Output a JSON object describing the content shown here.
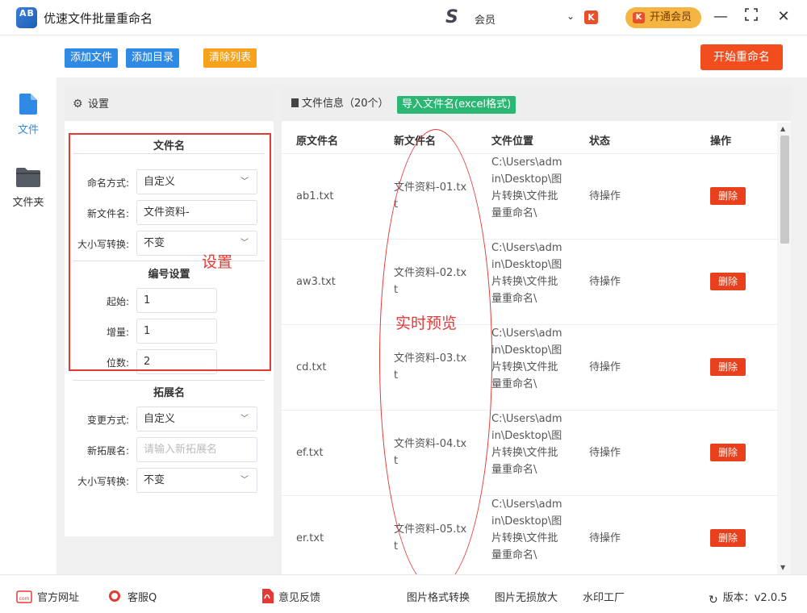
{
  "app": {
    "title": "优速文件批量重命名",
    "logo_text": "AB",
    "brand_logo": "S",
    "user_name": "会员",
    "brand_mark": "K",
    "vip_button": "开通会员",
    "min_glyph": "—",
    "max_glyph": "⛶",
    "close_glyph": "✕"
  },
  "nav": {
    "items": [
      {
        "label": "文件",
        "icon": "file-icon",
        "active": true
      },
      {
        "label": "文件夹",
        "icon": "folder-icon",
        "active": false
      }
    ]
  },
  "toolbar": {
    "add_file": "添加文件",
    "add_dir": "添加目录",
    "clear_list": "清除列表",
    "start_rename": "开始重命名"
  },
  "settings": {
    "header": "设置",
    "filename_section": "文件名",
    "naming_label": "命名方式:",
    "naming_value": "自定义",
    "newname_label": "新文件名:",
    "newname_value": "文件资料-",
    "case_label": "大小写转换:",
    "case_value": "不变",
    "numbering_section": "编号设置",
    "start_label": "起始:",
    "start_value": "1",
    "step_label": "增量:",
    "step_value": "1",
    "digits_label": "位数:",
    "digits_value": "2",
    "ext_section": "拓展名",
    "ext_mode_label": "变更方式:",
    "ext_mode_value": "自定义",
    "ext_new_label": "新拓展名:",
    "ext_new_placeholder": "请输入新拓展名",
    "ext_case_label": "大小写转换:",
    "ext_case_value": "不变"
  },
  "annotations": {
    "settings": "设置",
    "preview": "实时预览"
  },
  "filelist": {
    "header": "文件信息（20个）",
    "import_button": "导入文件名(excel格式)",
    "columns": [
      "原文件名",
      "新文件名",
      "文件位置",
      "状态",
      "操作"
    ],
    "rows": [
      {
        "original": "ab1.txt",
        "new": "文件资料-01.txt",
        "location": "C:\\Users\\admin\\Desktop\\图片转换\\文件批量重命名\\",
        "status": "待操作",
        "action": "删除"
      },
      {
        "original": "aw3.txt",
        "new": "文件资料-02.txt",
        "location": "C:\\Users\\admin\\Desktop\\图片转换\\文件批量重命名\\",
        "status": "待操作",
        "action": "删除"
      },
      {
        "original": "cd.txt",
        "new": "文件资料-03.txt",
        "location": "C:\\Users\\admin\\Desktop\\图片转换\\文件批量重命名\\",
        "status": "待操作",
        "action": "删除"
      },
      {
        "original": "ef.txt",
        "new": "文件资料-04.txt",
        "location": "C:\\Users\\admin\\Desktop\\图片转换\\文件批量重命名\\",
        "status": "待操作",
        "action": "删除"
      },
      {
        "original": "er.txt",
        "new": "文件资料-05.txt",
        "location": "C:\\Users\\admin\\Desktop\\图片转换\\文件批量重命名\\",
        "status": "待操作",
        "action": "删除"
      }
    ]
  },
  "footer": {
    "website": "官方网址",
    "support": "客服Q",
    "feedback": "意见反馈",
    "link1": "图片格式转换",
    "link2": "图片无损放大",
    "link3": "水印工厂",
    "version": "版本：v2.0.5"
  },
  "colors": {
    "blue_button": "#2f8ae5",
    "orange_button": "#f7a21c",
    "start_button": "#f24d1f",
    "import_button": "#2bb673",
    "delete_button": "#e8401c",
    "annotation": "#e53935"
  }
}
